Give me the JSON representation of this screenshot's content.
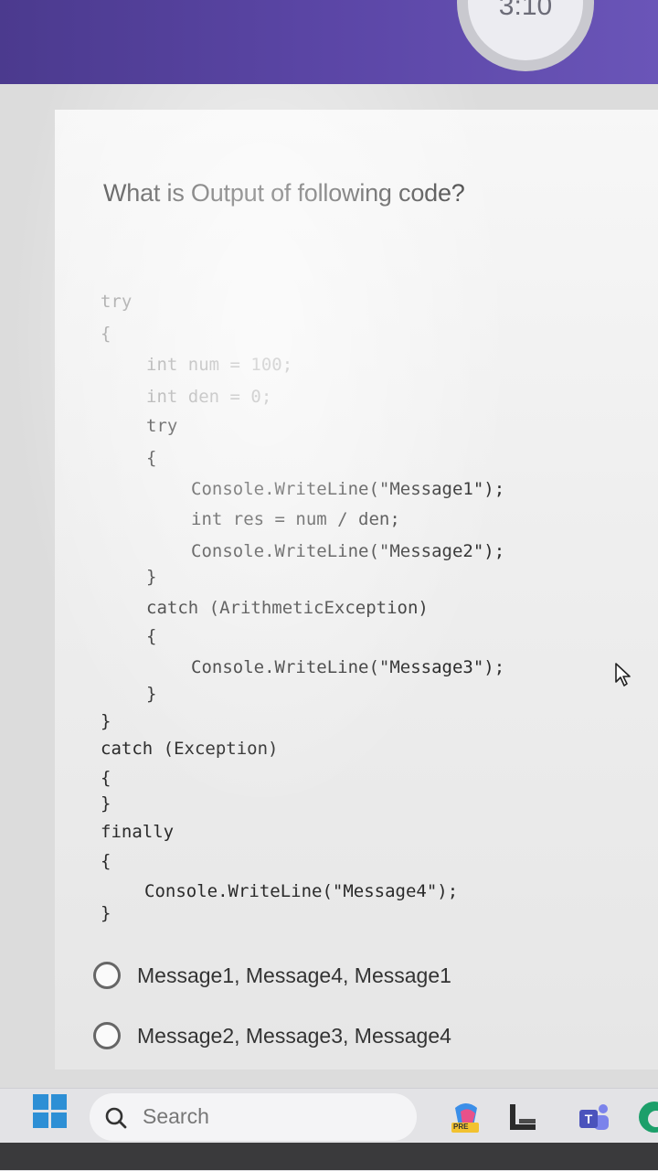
{
  "timer": {
    "text": "3:10"
  },
  "question": {
    "text": "What is Output of following code?"
  },
  "code_lines": [
    "try",
    "{",
    "int num = 100;",
    "int den = 0;",
    "try",
    "{",
    "Console.WriteLine(\"Message1\");",
    "int res = num / den;",
    "Console.WriteLine(\"Message2\");",
    "}",
    "catch (ArithmeticException)",
    "{",
    "Console.WriteLine(\"Message3\");",
    "}",
    "}",
    "catch (Exception)",
    "{",
    "}",
    "finally",
    "{",
    "Console.WriteLine(\"Message4\");",
    "}"
  ],
  "options": [
    {
      "label": "Message1, Message4, Message1"
    },
    {
      "label": "Message2, Message3, Message4"
    }
  ],
  "taskbar": {
    "search_label": "Search",
    "copilot_badge": "PRE"
  }
}
